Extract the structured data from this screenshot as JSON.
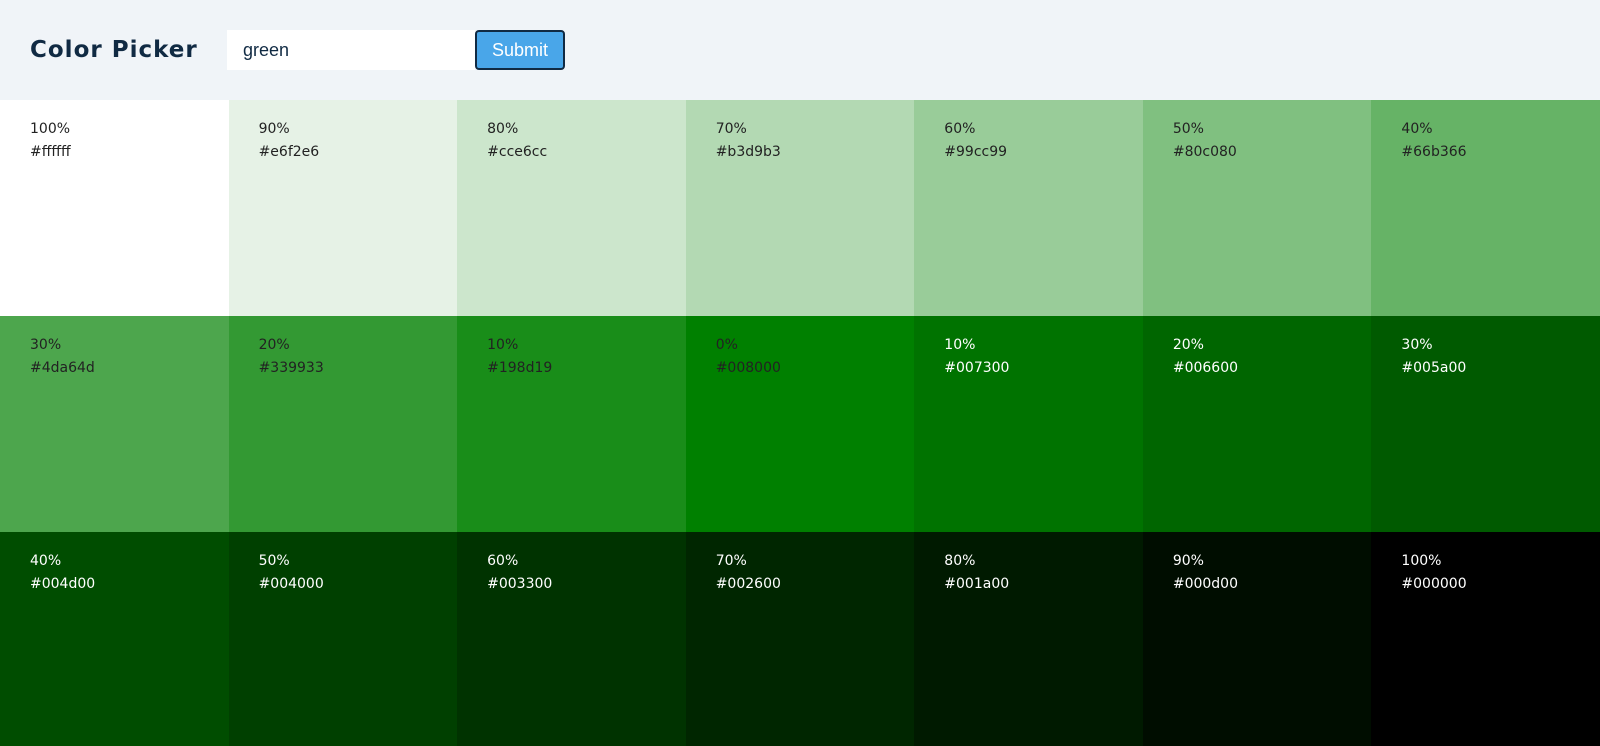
{
  "header": {
    "title": "Color Picker",
    "input_value": "green",
    "submit_label": "Submit"
  },
  "colors": {
    "accent": "#49a6e9",
    "header_bg": "#f0f4f8",
    "title_color": "#102a43"
  },
  "swatches": [
    {
      "percent": "100%",
      "hex": "#ffffff",
      "light_text": false
    },
    {
      "percent": "90%",
      "hex": "#e6f2e6",
      "light_text": false
    },
    {
      "percent": "80%",
      "hex": "#cce6cc",
      "light_text": false
    },
    {
      "percent": "70%",
      "hex": "#b3d9b3",
      "light_text": false
    },
    {
      "percent": "60%",
      "hex": "#99cc99",
      "light_text": false
    },
    {
      "percent": "50%",
      "hex": "#80c080",
      "light_text": false
    },
    {
      "percent": "40%",
      "hex": "#66b366",
      "light_text": false
    },
    {
      "percent": "30%",
      "hex": "#4da64d",
      "light_text": false
    },
    {
      "percent": "20%",
      "hex": "#339933",
      "light_text": false
    },
    {
      "percent": "10%",
      "hex": "#198d19",
      "light_text": false
    },
    {
      "percent": "0%",
      "hex": "#008000",
      "light_text": false
    },
    {
      "percent": "10%",
      "hex": "#007300",
      "light_text": true
    },
    {
      "percent": "20%",
      "hex": "#006600",
      "light_text": true
    },
    {
      "percent": "30%",
      "hex": "#005a00",
      "light_text": true
    },
    {
      "percent": "40%",
      "hex": "#004d00",
      "light_text": true
    },
    {
      "percent": "50%",
      "hex": "#004000",
      "light_text": true
    },
    {
      "percent": "60%",
      "hex": "#003300",
      "light_text": true
    },
    {
      "percent": "70%",
      "hex": "#002600",
      "light_text": true
    },
    {
      "percent": "80%",
      "hex": "#001a00",
      "light_text": true
    },
    {
      "percent": "90%",
      "hex": "#000d00",
      "light_text": true
    },
    {
      "percent": "100%",
      "hex": "#000000",
      "light_text": true
    }
  ]
}
